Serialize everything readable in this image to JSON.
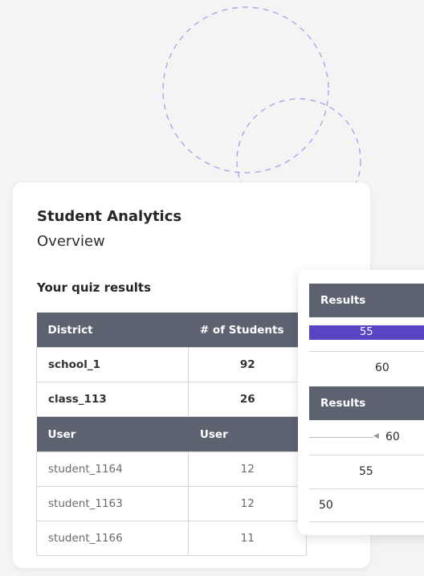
{
  "card": {
    "title": "Student Analytics",
    "subtitle": "Overview",
    "section_title": "Your quiz results",
    "table": {
      "header": [
        "District",
        "# of Students"
      ],
      "rows": [
        {
          "name": "school_1",
          "value": "92"
        },
        {
          "name": "class_113",
          "value": "26"
        }
      ],
      "subheader": [
        "User",
        "User"
      ],
      "user_rows": [
        {
          "name": "student_1164",
          "value": "12"
        },
        {
          "name": "student_1163",
          "value": "12"
        },
        {
          "name": "student_1166",
          "value": "11"
        }
      ]
    }
  },
  "results_panel": {
    "header1": "Results",
    "bar_value": "55",
    "row1_value": "60",
    "header2": "Results",
    "slider_value": "60",
    "row3_value": "55",
    "row4_value": "50"
  },
  "colors": {
    "header_bg": "#5c6270",
    "accent_bar": "#5b44c4",
    "dashed_circle": "#a9a7e8"
  }
}
